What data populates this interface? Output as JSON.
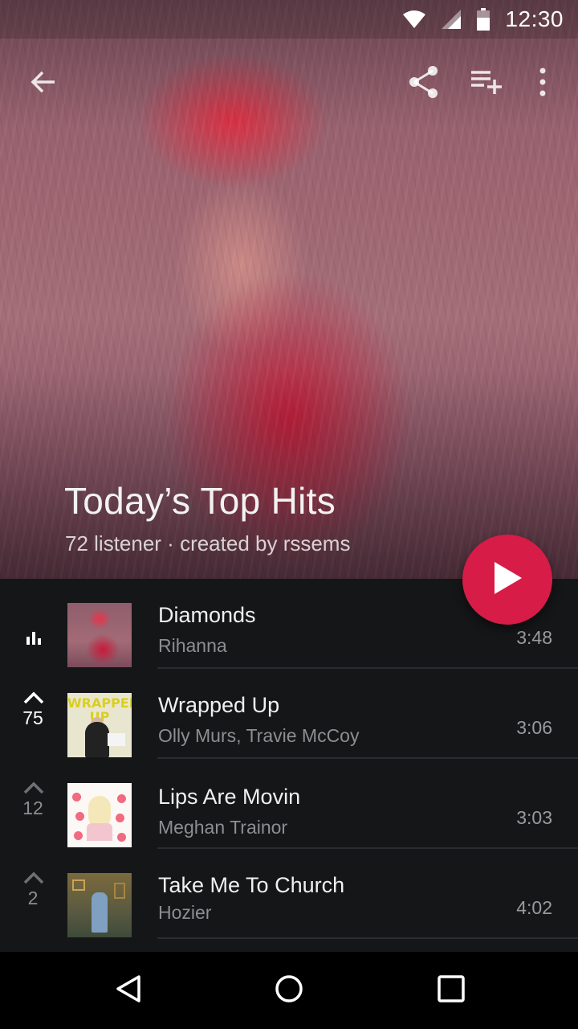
{
  "status_bar": {
    "time": "12:30",
    "icons": [
      "wifi-icon",
      "cell-signal-icon",
      "battery-icon"
    ]
  },
  "toolbar": {
    "icons": [
      "back-arrow-icon",
      "share-icon",
      "add-to-queue-icon",
      "more-vert-icon"
    ]
  },
  "playlist": {
    "title": "Today’s Top Hits",
    "subtitle": "72 listener · created by rssems"
  },
  "fab": {
    "icon": "play-icon",
    "color": "#d61c47"
  },
  "tracks": [
    {
      "title": "Diamonds",
      "artist": "Rihanna",
      "duration": "3:48",
      "rank": "",
      "state": "playing"
    },
    {
      "title": "Wrapped Up",
      "artist": "Olly Murs, Travie McCoy",
      "duration": "3:06",
      "rank": "75",
      "state": "voted",
      "art_text": "WRAPPED UP"
    },
    {
      "title": "Lips Are Movin",
      "artist": "Meghan Trainor",
      "duration": "3:03",
      "rank": "12",
      "state": "normal"
    },
    {
      "title": "Take Me To Church",
      "artist": "Hozier",
      "duration": "4:02",
      "rank": "2",
      "state": "normal"
    }
  ],
  "nav_bar": {
    "icons": [
      "nav-back-icon",
      "nav-home-icon",
      "nav-recents-icon"
    ]
  },
  "colors": {
    "accent": "#d61c47",
    "list_bg": "#151618",
    "secondary_text": "#8d8e91"
  }
}
